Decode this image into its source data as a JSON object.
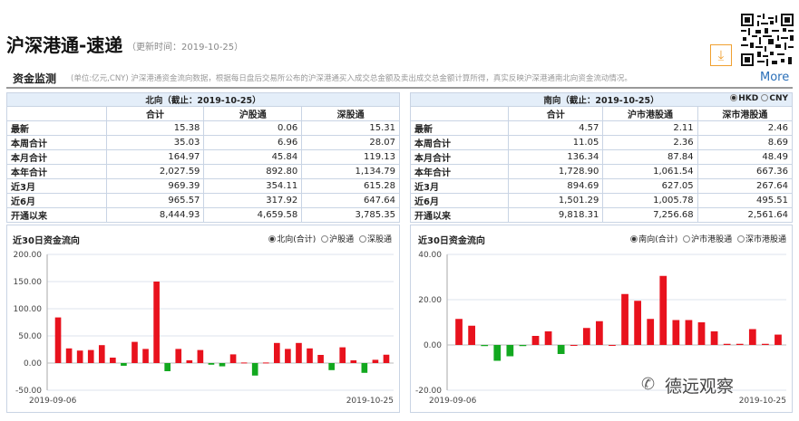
{
  "header": {
    "title": "沪深港通-速递",
    "update_label": "（更新时间：2019-10-25）",
    "more_label": "More",
    "section_title": "资金监测",
    "description": "(单位:亿元,CNY)  沪深港通资金流向数据，根据每日盘后交易所公布的沪深港通买入成交总金额及卖出成交总金额计算所得，真实反映沪深港通南北向资金流动情况。"
  },
  "north": {
    "caption": "北向（截止：2019-10-25）",
    "columns": [
      "",
      "合计",
      "沪股通",
      "深股通"
    ],
    "rows": [
      [
        "最新",
        "15.38",
        "0.06",
        "15.31"
      ],
      [
        "本周合计",
        "35.03",
        "6.96",
        "28.07"
      ],
      [
        "本月合计",
        "164.97",
        "45.84",
        "119.13"
      ],
      [
        "本年合计",
        "2,027.59",
        "892.80",
        "1,134.79"
      ],
      [
        "近3月",
        "969.39",
        "354.11",
        "615.28"
      ],
      [
        "近6月",
        "965.57",
        "317.92",
        "647.64"
      ],
      [
        "开通以来",
        "8,444.93",
        "4,659.58",
        "3,785.35"
      ]
    ],
    "chart_title": "近30日资金流向",
    "options": [
      "北向(合计)",
      "沪股通",
      "深股通"
    ],
    "selected_option": 0
  },
  "south": {
    "caption": "南向（截止：2019-10-25）",
    "currency": [
      "HKD",
      "CNY"
    ],
    "selected_currency": 0,
    "columns": [
      "",
      "合计",
      "沪市港股通",
      "深市港股通"
    ],
    "rows": [
      [
        "最新",
        "4.57",
        "2.11",
        "2.46"
      ],
      [
        "本周合计",
        "11.05",
        "2.36",
        "8.69"
      ],
      [
        "本月合计",
        "136.34",
        "87.84",
        "48.49"
      ],
      [
        "本年合计",
        "1,728.90",
        "1,061.54",
        "667.36"
      ],
      [
        "近3月",
        "894.69",
        "627.05",
        "267.64"
      ],
      [
        "近6月",
        "1,501.29",
        "1,005.78",
        "495.51"
      ],
      [
        "开通以来",
        "9,818.31",
        "7,256.68",
        "2,561.64"
      ]
    ],
    "chart_title": "近30日资金流向",
    "options": [
      "南向(合计)",
      "沪市港股通",
      "深市港股通"
    ],
    "selected_option": 0
  },
  "colors": {
    "positive": "#e8121d",
    "negative": "#12a81f",
    "header_bg": "#e4eef9",
    "border": "#c9d4e4"
  },
  "watermark": "德远观察",
  "chart_data": [
    {
      "type": "bar",
      "ylim": [
        -50,
        200
      ],
      "yticks": [
        "200.00",
        "150.00",
        "100.00",
        "50.00",
        "0.00",
        "-50.00"
      ],
      "ytick_values": [
        200,
        150,
        100,
        50,
        0,
        -50
      ],
      "x_start": "2019-09-06",
      "x_end": "2019-10-25",
      "values": [
        84,
        27,
        23,
        24,
        33,
        10,
        -5,
        39,
        26,
        150,
        -15,
        26,
        5,
        24,
        -3,
        -6,
        16,
        1,
        -23,
        1,
        37,
        26,
        37,
        27,
        15,
        -13,
        29,
        5,
        -18,
        6,
        15.38
      ]
    },
    {
      "type": "bar",
      "ylim": [
        -20,
        40
      ],
      "yticks": [
        "40.00",
        "20.00",
        "0.00",
        "-20.00"
      ],
      "ytick_values": [
        40,
        20,
        0,
        -20
      ],
      "x_start": "2019-09-06",
      "x_end": "2019-10-25",
      "values": [
        11.5,
        8.5,
        -0.5,
        -7,
        -5,
        -0.5,
        4,
        6,
        -4,
        0,
        7.5,
        10.5,
        0,
        22.5,
        19.5,
        11.5,
        30.5,
        11,
        11,
        10,
        6,
        0.5,
        0.5,
        7,
        0.5,
        4.57
      ]
    }
  ]
}
